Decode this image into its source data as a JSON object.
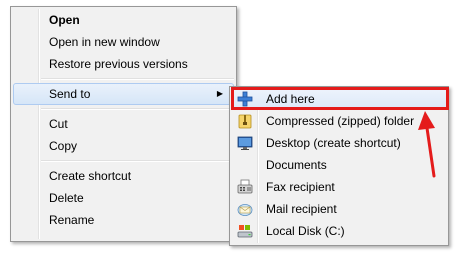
{
  "main_menu": {
    "items": [
      {
        "label": "Open"
      },
      {
        "label": "Open in new window"
      },
      {
        "label": "Restore previous versions"
      },
      {
        "label": "Send to"
      },
      {
        "label": "Cut"
      },
      {
        "label": "Copy"
      },
      {
        "label": "Create shortcut"
      },
      {
        "label": "Delete"
      },
      {
        "label": "Rename"
      }
    ],
    "submenu_arrow": "▶"
  },
  "send_to_menu": {
    "items": [
      {
        "label": "Add here",
        "icon": "plus-icon"
      },
      {
        "label": "Compressed (zipped) folder",
        "icon": "zip-folder-icon"
      },
      {
        "label": "Desktop (create shortcut)",
        "icon": "desktop-icon"
      },
      {
        "label": "Documents",
        "icon": "documents-icon"
      },
      {
        "label": "Fax recipient",
        "icon": "fax-icon"
      },
      {
        "label": "Mail recipient",
        "icon": "mail-icon"
      },
      {
        "label": "Local Disk (C:)",
        "icon": "local-disk-icon"
      }
    ]
  },
  "colors": {
    "highlight": "#e41b1b",
    "menu_bg": "#f1f1f1",
    "selected_bg": "#d6e6f8"
  }
}
